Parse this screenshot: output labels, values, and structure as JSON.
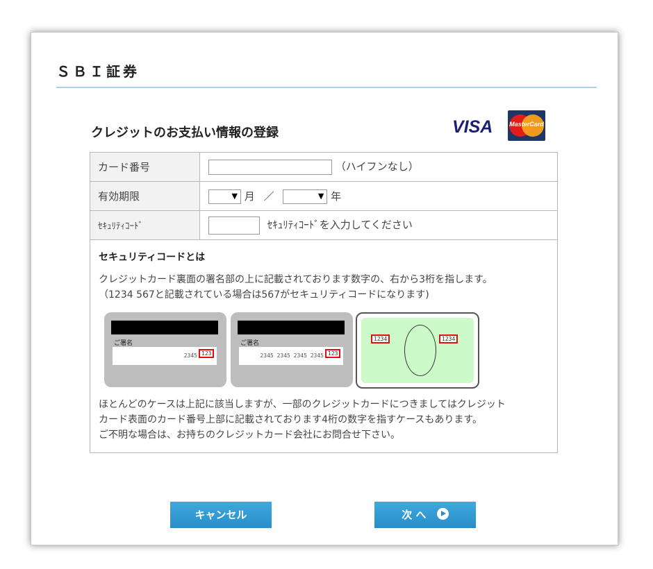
{
  "brand": "ＳＢＩ証券",
  "heading": "クレジットのお支払い情報の登録",
  "logos": {
    "visa": "VISA",
    "mastercard": "MasterCard"
  },
  "form": {
    "card_number": {
      "label": "カード番号",
      "value": "",
      "hint": "（ハイフンなし）"
    },
    "expiry": {
      "label": "有効期限",
      "month_value": "",
      "month_unit": "月",
      "separator": "／",
      "year_value": "",
      "year_unit": "年"
    },
    "security_code": {
      "label": "ｾｷｭﾘﾃｨｺｰﾄﾞ",
      "value": "",
      "hint": "ｾｷｭﾘﾃｨｺｰﾄﾞを入力してください"
    }
  },
  "info": {
    "title": "セキュリティコードとは",
    "text1": "クレジットカード裏面の署名部の上に記載されております数字の、右から3桁を指します。",
    "text2": "（1234 567と記載されている場合は567がセキュリティコードになります)",
    "card1": {
      "sig_label": "ご署名",
      "number": "2345",
      "code": "123"
    },
    "card2": {
      "sig_label": "ご署名",
      "number": "2345 2345 2345 2345",
      "code": "123"
    },
    "card3": {
      "left_code": "1234",
      "right_code": "1234"
    },
    "text3": "ほとんどのケースは上記に該当しますが、一部のクレジットカードにつきましてはクレジット",
    "text4": "カード表面のカード番号上部に記載されております4桁の数字を指すケースもあります。",
    "text5": "ご不明な場合は、お持ちのクレジットカード会社にお問合せ下さい。"
  },
  "buttons": {
    "cancel": "キャンセル",
    "next": "次 へ"
  },
  "icons": {
    "next": "circle-arrow-right-icon"
  }
}
